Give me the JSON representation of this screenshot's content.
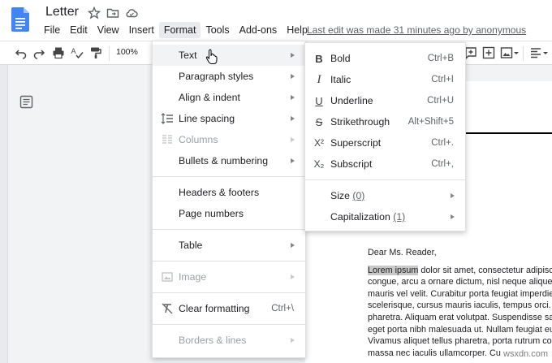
{
  "header": {
    "title": "Letter",
    "last_edit": "Last edit was made 31 minutes ago by anonymous",
    "menus": [
      {
        "label": "File"
      },
      {
        "label": "Edit"
      },
      {
        "label": "View"
      },
      {
        "label": "Insert"
      },
      {
        "label": "Format",
        "active": true
      },
      {
        "label": "Tools"
      },
      {
        "label": "Add-ons"
      },
      {
        "label": "Help"
      }
    ]
  },
  "toolbar": {
    "zoom": "100%",
    "icons": [
      "undo-icon",
      "redo-icon",
      "print-icon",
      "spellcheck-icon",
      "paint-format-icon",
      "comment-icon",
      "insert-image-icon",
      "align-left-icon"
    ]
  },
  "format_menu": {
    "items": [
      {
        "label": "Text",
        "submenu": true,
        "hover": true
      },
      {
        "label": "Paragraph styles",
        "submenu": true
      },
      {
        "label": "Align & indent",
        "submenu": true
      },
      {
        "label": "Line spacing",
        "submenu": true,
        "icon": "line-spacing-icon"
      },
      {
        "label": "Columns",
        "submenu": true,
        "disabled": true,
        "icon": "columns-icon"
      },
      {
        "label": "Bullets & numbering",
        "submenu": true
      },
      {
        "label": "Headers & footers"
      },
      {
        "label": "Page numbers"
      },
      {
        "label": "Table",
        "submenu": true
      },
      {
        "label": "Image",
        "submenu": true,
        "disabled": true,
        "icon": "image-icon"
      },
      {
        "label": "Clear formatting",
        "shortcut": "Ctrl+\\",
        "icon": "clear-formatting-icon"
      },
      {
        "label": "Borders & lines",
        "submenu": true,
        "disabled": true
      }
    ]
  },
  "text_menu": {
    "items": [
      {
        "icon_glyph": "B",
        "label": "Bold",
        "shortcut": "Ctrl+B"
      },
      {
        "icon_glyph": "I",
        "label": "Italic",
        "shortcut": "Ctrl+I"
      },
      {
        "icon_glyph": "U",
        "label": "Underline",
        "shortcut": "Ctrl+U"
      },
      {
        "icon_glyph": "S",
        "label": "Strikethrough",
        "shortcut": "Alt+Shift+5"
      },
      {
        "icon_glyph": "X²",
        "label": "Superscript",
        "shortcut": "Ctrl+."
      },
      {
        "icon_glyph": "X₂",
        "label": "Subscript",
        "shortcut": "Ctrl+,"
      }
    ],
    "sub_items": [
      {
        "label": "Size",
        "hint": "(0)"
      },
      {
        "label": "Capitalization",
        "hint": "(1)"
      }
    ]
  },
  "document": {
    "salutation": "Dear Ms. Reader,",
    "highlighted": "Lorem ipsum",
    "first_line_rest": " dolor sit amet, consectetur adipisci",
    "lines": [
      "congue, arcu a ornare dictum, nisl neque aliquet e",
      "mauris vel velit. Curabitur porta feugiat imperdie",
      "scelerisque, cursus mauris iaculis, tempus orci. N",
      "pharetra. Aliquam erat volutpat. Suspendisse sag",
      "eget porta nibh malesuada ut. Nullam feugiat eui",
      "Vivamus aliquet tellus pharetra, porta rutrum co",
      "massa nec iaculis ullamcorper. Cu"
    ]
  },
  "watermark": "wsxdn.com"
}
